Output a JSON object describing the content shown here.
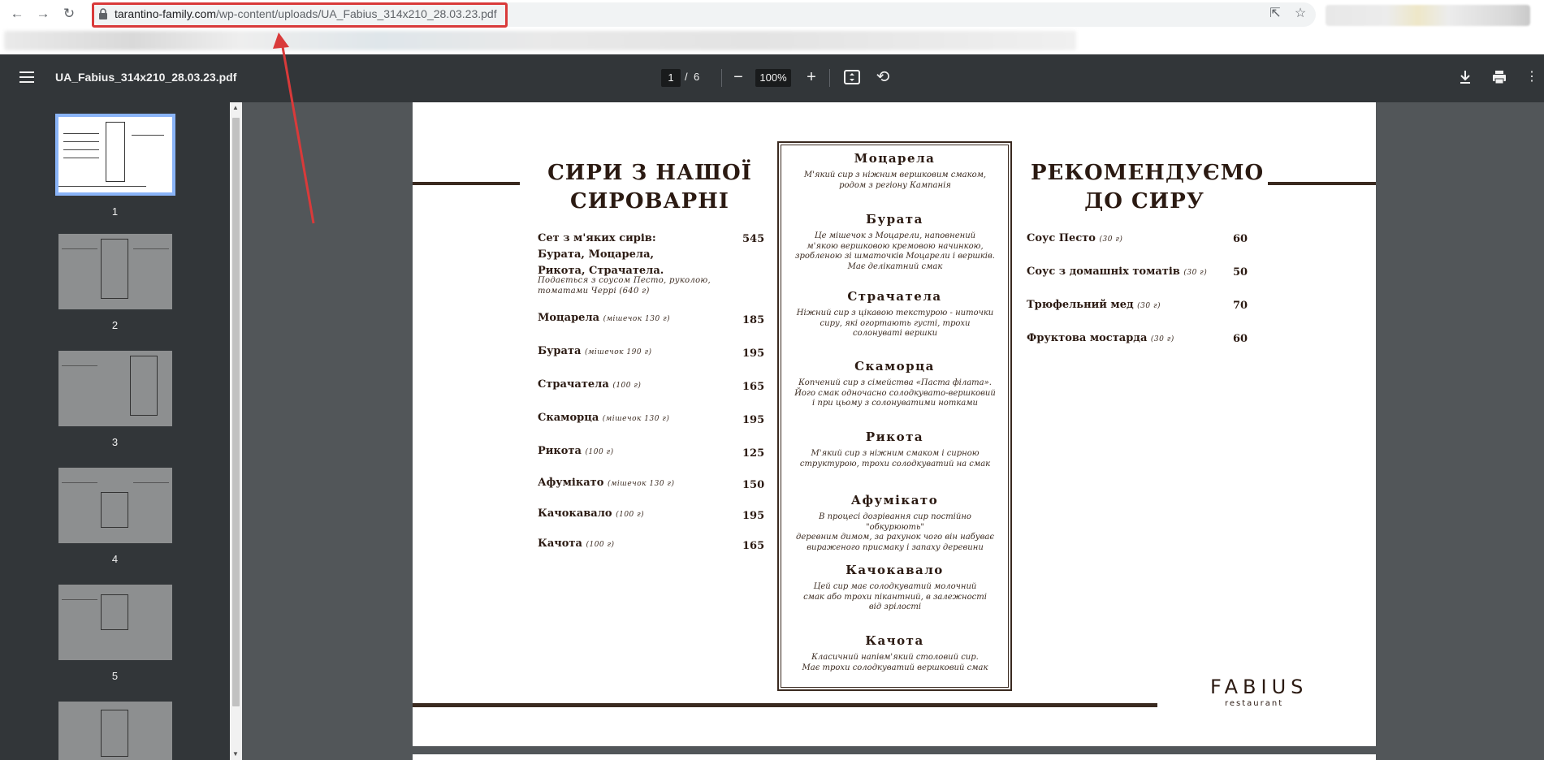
{
  "browser": {
    "url_host": "tarantino-family.com",
    "url_path": "/wp-content/uploads/UA_Fabius_314x210_28.03.23.pdf"
  },
  "pdf_toolbar": {
    "file_name": "UA_Fabius_314x210_28.03.23.pdf",
    "current_page": "1",
    "separator": "/",
    "total_pages": "6",
    "zoom": "100%"
  },
  "thumbnails": [
    {
      "label": "1"
    },
    {
      "label": "2"
    },
    {
      "label": "3"
    },
    {
      "label": "4"
    },
    {
      "label": "5"
    }
  ],
  "menu": {
    "left_title": "СИРИ З НАШОЇ СИРОВАРНІ",
    "left_title_line1": "СИРИ З НАШОЇ",
    "left_title_line2": "СИРОВАРНІ",
    "set": {
      "line1": "Сет з м'яких сирів:",
      "line2": "Бурата, Моцарела,",
      "line3": "Рикота, Страчатела.",
      "desc1": "Подається з соусом Песто, руколою,",
      "desc2": "томатами Черрі (640 г)",
      "price": "545"
    },
    "cheeses": [
      {
        "name": "Моцарела",
        "note": "(мішечок 130 г)",
        "price": "185"
      },
      {
        "name": "Бурата",
        "note": "(мішечок 190 г)",
        "price": "195"
      },
      {
        "name": "Страчатела",
        "note": "(100 г)",
        "price": "165"
      },
      {
        "name": "Скаморца",
        "note": "(мішечок 130 г)",
        "price": "195"
      },
      {
        "name": "Рикота",
        "note": "(100 г)",
        "price": "125"
      },
      {
        "name": "Афумікато",
        "note": "(мішечок 130 г)",
        "price": "150"
      },
      {
        "name": "Качокавало",
        "note": "(100 г)",
        "price": "195"
      },
      {
        "name": "Качота",
        "note": "(100 г)",
        "price": "165"
      }
    ],
    "center": [
      {
        "head": "Моцарела",
        "lines": [
          "М'який сир з ніжним вершковим смаком,",
          "родом з регіону Кампанія"
        ]
      },
      {
        "head": "Бурата",
        "lines": [
          "Це мішечок з Моцарели, наповнений",
          "м'якою вершковою кремовою начинкою,",
          "зробленою зі шматочків Моцарели і вершків.",
          "Має делікатний смак"
        ]
      },
      {
        "head": "Страчатела",
        "lines": [
          "Ніжний сир з цікавою текстурою - ниточки",
          "сиру, які огортають густі, трохи",
          "солонуваті вершки"
        ]
      },
      {
        "head": "Скаморца",
        "lines": [
          "Копчений сир з сімейства «Паста філата».",
          "Його смак одночасно солодкувато-вершковий",
          "і при цьому з солонуватими нотками"
        ]
      },
      {
        "head": "Рикота",
        "lines": [
          "М'який сир з ніжним смаком і сирною",
          "структурою, трохи солодкуватий на смак"
        ]
      },
      {
        "head": "Афумікато",
        "lines": [
          "В процесі дозрівання сир постійно \"обкурюють\"",
          "деревним димом, за рахунок чого він набуває",
          "вираженого присмаку і запаху деревини"
        ]
      },
      {
        "head": "Качокавало",
        "lines": [
          "Цей сир має солодкуватий молочний",
          "смак або трохи пікантний, в залежності",
          "від зрілості"
        ]
      },
      {
        "head": "Качота",
        "lines": [
          "Класичний напівм'який столовий сир.",
          "Має трохи солодкуватий вершковий смак"
        ]
      }
    ],
    "right_title_line1": "РЕКОМЕНДУЄМО",
    "right_title_line2": "ДО СИРУ",
    "sauces": [
      {
        "name": "Соус Песто",
        "note": "(30 г)",
        "price": "60"
      },
      {
        "name": "Соус з домашніх томатів",
        "note": "(30 г)",
        "price": "50"
      },
      {
        "name": "Трюфельний мед",
        "note": "(30 г)",
        "price": "70"
      },
      {
        "name": "Фруктова мостарда",
        "note": "(30 г)",
        "price": "60"
      }
    ],
    "logo": "FABIUS",
    "logo_sub": "restaurant"
  },
  "colors": {
    "annotation_red": "#d93a3a",
    "menu_brown": "#2b1a12",
    "toolbar_bg": "#323639"
  }
}
